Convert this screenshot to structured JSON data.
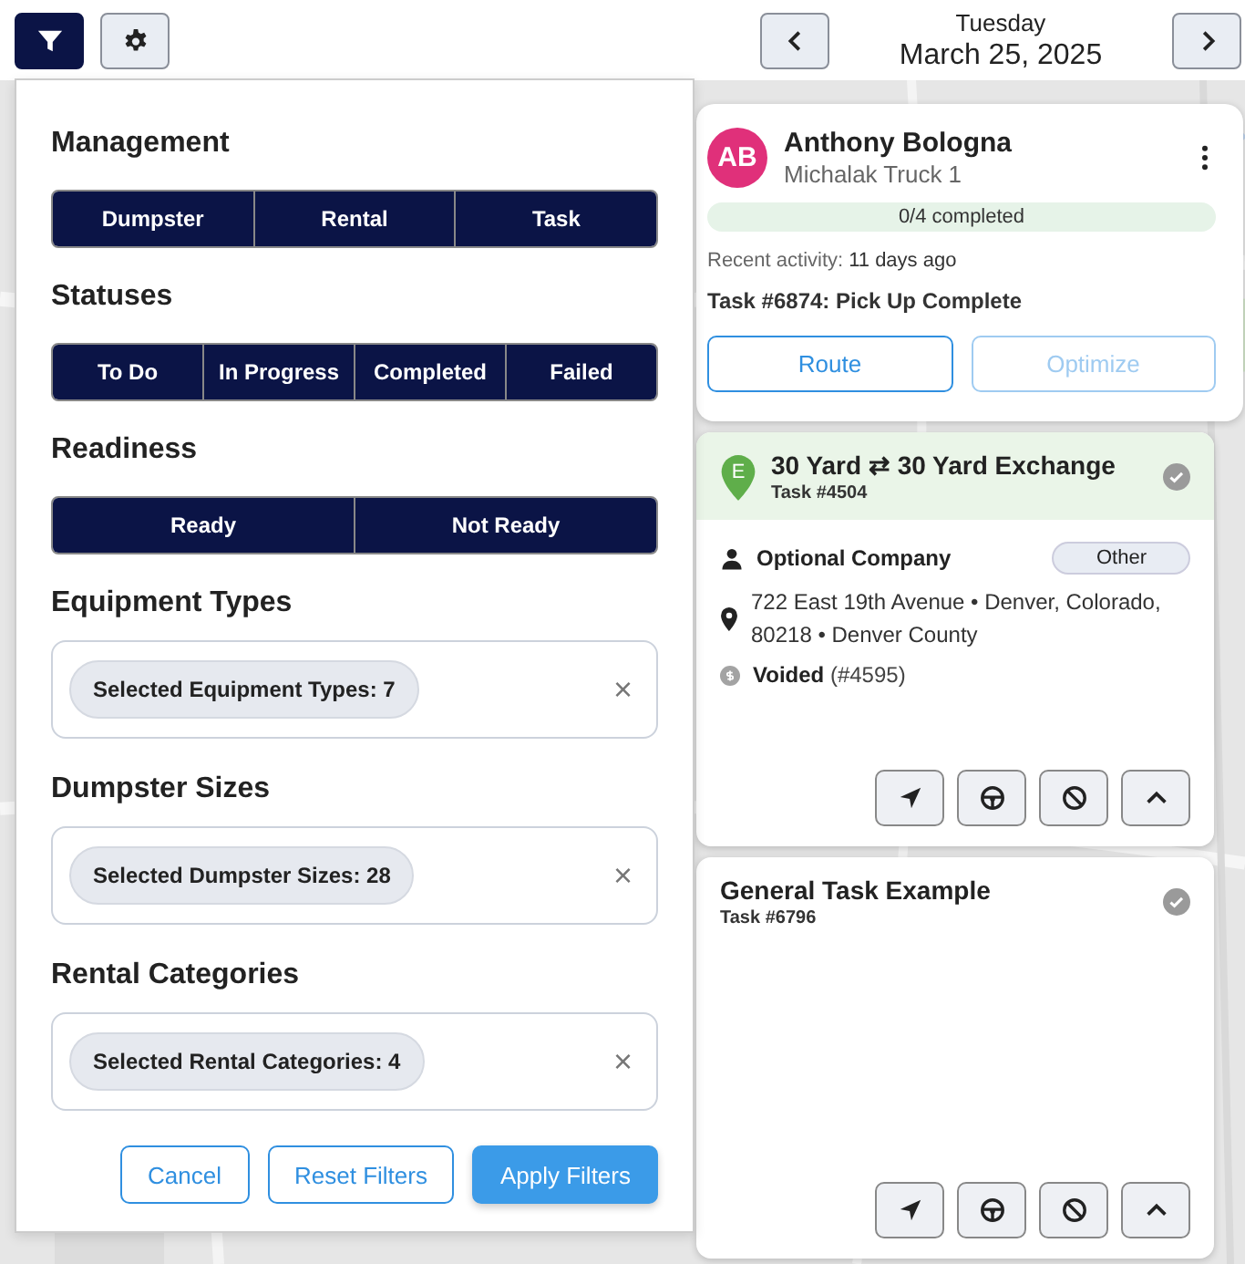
{
  "toolbar": {
    "filter_active": true,
    "date": {
      "weekday": "Tuesday",
      "date": "March 25, 2025"
    }
  },
  "filter_panel": {
    "groups": [
      {
        "kind": "toggle",
        "title": "Management",
        "options": [
          {
            "label": "Dumpster",
            "selected": true
          },
          {
            "label": "Rental",
            "selected": true
          },
          {
            "label": "Task",
            "selected": true
          }
        ]
      },
      {
        "kind": "toggle",
        "title": "Statuses",
        "options": [
          {
            "label": "To Do",
            "selected": true
          },
          {
            "label": "In Progress",
            "selected": true
          },
          {
            "label": "Completed",
            "selected": true
          },
          {
            "label": "Failed",
            "selected": true
          }
        ]
      },
      {
        "kind": "toggle",
        "title": "Readiness",
        "options": [
          {
            "label": "Ready",
            "selected": true
          },
          {
            "label": "Not Ready",
            "selected": true
          }
        ]
      },
      {
        "kind": "select",
        "title": "Equipment Types",
        "chip": "Selected Equipment Types: 7",
        "clear": "×"
      },
      {
        "kind": "select",
        "title": "Dumpster Sizes",
        "chip": "Selected Dumpster Sizes: 28",
        "clear": "×"
      },
      {
        "kind": "select",
        "title": "Rental Categories",
        "chip": "Selected Rental Categories: 4",
        "clear": "×"
      }
    ],
    "buttons": [
      {
        "label": "Cancel",
        "kind": "outline"
      },
      {
        "label": "Reset Filters",
        "kind": "outline"
      },
      {
        "label": "Apply Filters",
        "kind": "primary"
      }
    ]
  },
  "driver_card": {
    "initials": "AB",
    "color": "#e0307a",
    "name": "Anthony Bologna",
    "truck": "Michalak Truck 1",
    "progress": {
      "label": "0/4 completed",
      "level": 0
    },
    "recent_label": "Recent activity:",
    "recent_value": "11 days ago",
    "last_task": "Task #6874: Pick Up Complete",
    "buttons": [
      {
        "label": "Route",
        "disabled": false
      },
      {
        "label": "Optimize",
        "disabled": true
      }
    ]
  },
  "task_cards": [
    {
      "pin": "E",
      "title": "30 Yard ⇄ 30 Yard Exchange",
      "task": "Task #4504",
      "highlighted": true,
      "company": "Optional Company",
      "tag": "Other",
      "address": "722 East 19th Avenue • Denver, Colorado, 80218 • Denver County",
      "payment": "**Voided** (#4595)"
    },
    {
      "title": "General Task Example",
      "task": "Task #6796",
      "highlighted": false
    }
  ]
}
